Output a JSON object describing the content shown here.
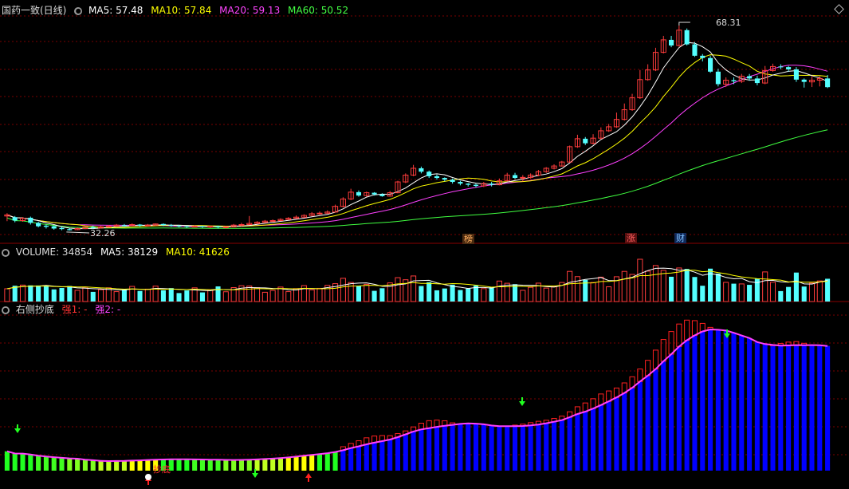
{
  "header": {
    "title": "国药一致(日线)",
    "ma5": "MA5: 57.48",
    "ma10": "MA10: 57.84",
    "ma20": "MA20: 59.13",
    "ma60": "MA60: 50.52"
  },
  "price_marks": {
    "high": "68.31",
    "low": "32.26"
  },
  "tags": [
    "榜",
    "涨",
    "财"
  ],
  "volume_header": {
    "title": "VOLUME: 34854",
    "ma5": "MA5: 38129",
    "ma10": "MA10: 41626"
  },
  "indicator_header": {
    "title": "右侧抄底",
    "s1": "强1: -",
    "s2": "强2: -"
  },
  "indicator_mark": "抄底",
  "colors": {
    "up": "#ff3c3c",
    "down": "#54ffff",
    "ma5": "#ffffff",
    "ma10": "#ffff00",
    "ma20": "#ff40ff",
    "ma60": "#40ff40",
    "grid": "#7a0000",
    "ind_blue": "#0000ff"
  },
  "chart_data": {
    "type": "candlestick",
    "ylim": [
      30,
      70
    ],
    "candles": [
      [
        34.8,
        35.0,
        33.9,
        35.3
      ],
      [
        34.6,
        34.0,
        33.7,
        34.8
      ],
      [
        34.0,
        34.4,
        33.8,
        34.6
      ],
      [
        34.5,
        33.6,
        33.3,
        34.7
      ],
      [
        33.6,
        33.0,
        32.8,
        33.8
      ],
      [
        33.1,
        32.9,
        32.6,
        33.3
      ],
      [
        33.0,
        32.6,
        32.4,
        33.1
      ],
      [
        32.7,
        32.5,
        32.3,
        32.9
      ],
      [
        32.5,
        32.3,
        32.26,
        32.7
      ],
      [
        32.4,
        32.6,
        32.3,
        32.8
      ],
      [
        32.6,
        32.9,
        32.5,
        33.0
      ],
      [
        32.9,
        32.7,
        32.5,
        33.1
      ],
      [
        32.7,
        32.9,
        32.6,
        33.1
      ],
      [
        32.9,
        33.0,
        32.8,
        33.2
      ],
      [
        33.0,
        33.2,
        32.9,
        33.4
      ],
      [
        33.2,
        33.1,
        32.9,
        33.4
      ],
      [
        33.1,
        33.3,
        33.0,
        33.5
      ],
      [
        33.3,
        33.1,
        32.9,
        33.4
      ],
      [
        33.1,
        33.2,
        33.0,
        33.4
      ],
      [
        33.2,
        33.4,
        33.1,
        33.5
      ],
      [
        33.4,
        33.2,
        33.0,
        33.5
      ],
      [
        33.2,
        33.1,
        32.9,
        33.4
      ],
      [
        33.1,
        33.0,
        32.8,
        33.2
      ],
      [
        33.0,
        32.9,
        32.7,
        33.1
      ],
      [
        32.9,
        33.0,
        32.8,
        33.2
      ],
      [
        33.0,
        32.9,
        32.7,
        33.1
      ],
      [
        32.9,
        33.0,
        32.7,
        33.1
      ],
      [
        33.0,
        32.8,
        32.6,
        33.1
      ],
      [
        32.8,
        32.9,
        32.6,
        33.0
      ],
      [
        32.9,
        33.2,
        32.8,
        33.4
      ],
      [
        33.2,
        33.3,
        33.0,
        33.6
      ],
      [
        33.3,
        33.5,
        33.2,
        34.8
      ],
      [
        33.5,
        33.7,
        33.4,
        33.9
      ],
      [
        33.7,
        33.9,
        33.6,
        34.1
      ],
      [
        33.9,
        34.0,
        33.8,
        34.2
      ],
      [
        34.0,
        34.2,
        33.9,
        34.4
      ],
      [
        34.2,
        34.4,
        34.1,
        34.6
      ],
      [
        34.4,
        34.6,
        34.3,
        34.9
      ],
      [
        34.6,
        34.9,
        34.5,
        35.1
      ],
      [
        34.9,
        35.2,
        34.8,
        35.5
      ],
      [
        35.2,
        35.3,
        35.0,
        35.6
      ],
      [
        35.3,
        35.5,
        35.2,
        35.8
      ],
      [
        35.5,
        36.5,
        35.4,
        36.8
      ],
      [
        36.5,
        37.8,
        36.3,
        38.1
      ],
      [
        37.8,
        39.0,
        37.6,
        39.6
      ],
      [
        39.0,
        38.4,
        38.2,
        39.3
      ],
      [
        38.4,
        38.9,
        38.2,
        39.1
      ],
      [
        38.9,
        38.6,
        38.4,
        39.0
      ],
      [
        38.6,
        38.3,
        38.2,
        38.8
      ],
      [
        38.3,
        38.9,
        38.2,
        39.2
      ],
      [
        38.9,
        40.8,
        38.8,
        41.0
      ],
      [
        40.8,
        42.0,
        40.6,
        42.3
      ],
      [
        42.0,
        43.2,
        41.8,
        43.8
      ],
      [
        43.2,
        42.6,
        42.3,
        43.5
      ],
      [
        42.6,
        41.8,
        41.5,
        42.8
      ],
      [
        41.8,
        41.5,
        41.2,
        42.1
      ],
      [
        41.5,
        41.2,
        40.9,
        41.6
      ],
      [
        41.2,
        40.8,
        40.5,
        41.4
      ],
      [
        40.8,
        40.5,
        40.2,
        41.0
      ],
      [
        40.5,
        40.3,
        40.0,
        40.6
      ],
      [
        40.3,
        40.1,
        39.8,
        40.5
      ],
      [
        40.1,
        40.5,
        39.9,
        40.8
      ],
      [
        40.5,
        40.3,
        40.0,
        40.8
      ],
      [
        40.3,
        41.0,
        40.2,
        41.4
      ],
      [
        41.0,
        42.0,
        40.9,
        42.4
      ],
      [
        42.0,
        41.5,
        41.3,
        42.4
      ],
      [
        41.5,
        41.6,
        40.9,
        42.0
      ],
      [
        41.6,
        42.0,
        41.4,
        42.3
      ],
      [
        42.0,
        42.6,
        41.8,
        42.9
      ],
      [
        42.6,
        43.2,
        42.4,
        43.4
      ],
      [
        43.2,
        43.6,
        43.0,
        43.9
      ],
      [
        43.6,
        44.3,
        43.5,
        44.5
      ],
      [
        44.3,
        47.0,
        44.2,
        47.2
      ],
      [
        47.0,
        48.4,
        46.8,
        49.1
      ],
      [
        48.4,
        47.6,
        47.3,
        48.7
      ],
      [
        47.6,
        48.5,
        47.4,
        49.2
      ],
      [
        48.5,
        49.8,
        48.3,
        50.4
      ],
      [
        49.8,
        50.5,
        49.6,
        51.0
      ],
      [
        50.5,
        51.8,
        50.3,
        53.0
      ],
      [
        51.8,
        53.5,
        51.6,
        54.6
      ],
      [
        53.5,
        55.6,
        53.3,
        56.3
      ],
      [
        55.6,
        58.8,
        55.4,
        60.5
      ],
      [
        58.8,
        60.5,
        58.6,
        61.5
      ],
      [
        60.5,
        63.6,
        60.3,
        64.4
      ],
      [
        63.6,
        65.8,
        63.4,
        66.5
      ],
      [
        65.8,
        64.8,
        64.5,
        66.5
      ],
      [
        64.8,
        67.5,
        64.6,
        68.31
      ],
      [
        67.5,
        65.0,
        64.8,
        67.8
      ],
      [
        65.0,
        63.0,
        62.8,
        65.4
      ],
      [
        63.0,
        62.6,
        62.0,
        63.3
      ],
      [
        62.6,
        60.2,
        60.0,
        63.0
      ],
      [
        60.2,
        58.0,
        57.6,
        60.7
      ],
      [
        58.0,
        58.7,
        57.5,
        59.2
      ],
      [
        58.7,
        58.5,
        58.0,
        59.2
      ],
      [
        58.5,
        59.4,
        58.2,
        59.8
      ],
      [
        59.4,
        59.0,
        58.6,
        59.8
      ],
      [
        59.0,
        58.2,
        57.8,
        59.5
      ],
      [
        58.2,
        60.4,
        58.0,
        61.2
      ],
      [
        60.4,
        61.1,
        60.2,
        61.6
      ],
      [
        61.1,
        61.0,
        60.6,
        61.5
      ],
      [
        61.0,
        60.6,
        60.2,
        61.2
      ],
      [
        60.6,
        58.8,
        58.4,
        61.0
      ],
      [
        58.8,
        58.4,
        57.4,
        59.0
      ],
      [
        58.4,
        58.7,
        57.5,
        59.4
      ],
      [
        58.7,
        59.0,
        57.6,
        59.4
      ],
      [
        59.0,
        57.48,
        57.3,
        59.6
      ]
    ]
  }
}
